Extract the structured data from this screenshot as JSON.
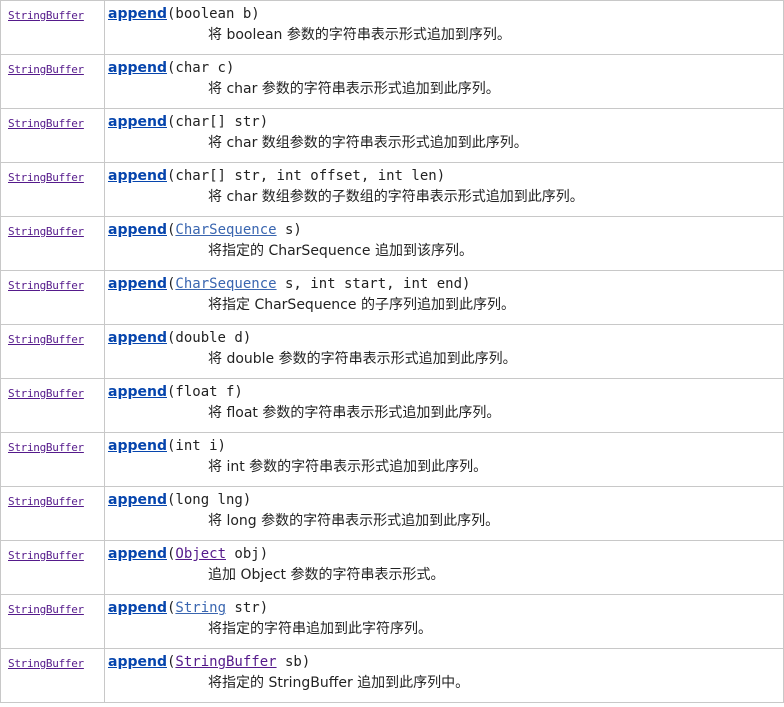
{
  "rows": [
    {
      "type": "StringBuffer",
      "method": "append",
      "params": "(boolean b)",
      "description": "将 boolean 参数的字符串表示形式追加到序列。"
    },
    {
      "type": "StringBuffer",
      "method": "append",
      "params": "(char c)",
      "description": "将 char 参数的字符串表示形式追加到此序列。"
    },
    {
      "type": "StringBuffer",
      "method": "append",
      "params": "(char[] str)",
      "description": "将 char 数组参数的字符串表示形式追加到此序列。"
    },
    {
      "type": "StringBuffer",
      "method": "append",
      "params": "(char[] str, int offset, int len)",
      "description": "将 char 数组参数的子数组的字符串表示形式追加到此序列。"
    },
    {
      "type": "StringBuffer",
      "method": "append",
      "param_open": "(",
      "param_type": "CharSequence",
      "param_rest": " s)",
      "description": "将指定的 CharSequence 追加到该序列。"
    },
    {
      "type": "StringBuffer",
      "method": "append",
      "param_open": "(",
      "param_type": "CharSequence",
      "param_rest": " s, int start, int end)",
      "description": "将指定 CharSequence 的子序列追加到此序列。"
    },
    {
      "type": "StringBuffer",
      "method": "append",
      "params": "(double d)",
      "description": "将 double 参数的字符串表示形式追加到此序列。"
    },
    {
      "type": "StringBuffer",
      "method": "append",
      "params": "(float f)",
      "description": "将 float 参数的字符串表示形式追加到此序列。"
    },
    {
      "type": "StringBuffer",
      "method": "append",
      "params": "(int i)",
      "description": "将 int 参数的字符串表示形式追加到此序列。"
    },
    {
      "type": "StringBuffer",
      "method": "append",
      "params": "(long lng)",
      "description": "将 long 参数的字符串表示形式追加到此序列。"
    },
    {
      "type": "StringBuffer",
      "method": "append",
      "param_open": "(",
      "param_type": "Object",
      "param_rest": " obj)",
      "description": "追加 Object 参数的字符串表示形式。"
    },
    {
      "type": "StringBuffer",
      "method": "append",
      "param_open": "(",
      "param_type": "String",
      "param_rest": " str)",
      "description": "将指定的字符串追加到此字符序列。"
    },
    {
      "type": "StringBuffer",
      "method": "append",
      "param_open": "(",
      "param_type": "StringBuffer",
      "param_rest": " sb)",
      "description": "将指定的 StringBuffer 追加到此序列中。"
    }
  ],
  "colors": {
    "link_visited": "#551a8b",
    "method_link": "#0645ad",
    "param_type_link": "#3a66b0",
    "border": "#c8c8c8"
  }
}
